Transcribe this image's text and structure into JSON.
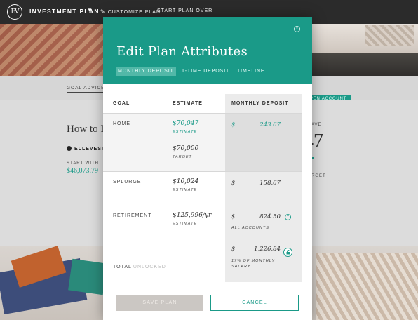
{
  "nav": {
    "logo": "EV",
    "title": "INVESTMENT PLAN",
    "customize": "CUSTOMIZE PLAN",
    "start_over": "START PLAN OVER"
  },
  "background": {
    "goal_advice": "GOAL ADVICE",
    "open_account": "PEN ACCOUNT",
    "heading": "How to I",
    "ellevest": "ELLEVEST",
    "start_with_label": "START WITH",
    "start_with_value": "$46,073.79",
    "save_label": "AVE",
    "big_value": "47",
    "target_label": "RGET"
  },
  "modal": {
    "title": "Edit Plan Attributes",
    "tabs": [
      "MONTHLY DEPOSIT",
      "1-TIME DEPOSIT",
      "TIMELINE"
    ],
    "active_tab": "MONTHLY DEPOSIT",
    "headers": {
      "goal": "GOAL",
      "estimate": "ESTIMATE",
      "deposit": "MONTHLY DEPOSIT"
    },
    "rows": [
      {
        "goal": "HOME",
        "estimate": "$70,047",
        "estimate_label": "ESTIMATE",
        "target": "$70,000",
        "target_label": "TARGET",
        "currency": "$",
        "deposit": "243.67"
      },
      {
        "goal": "SPLURGE",
        "estimate": "$10,024",
        "estimate_label": "ESTIMATE",
        "currency": "$",
        "deposit": "158.67"
      },
      {
        "goal": "RETIREMENT",
        "estimate": "$125,996/yr",
        "estimate_label": "ESTIMATE",
        "currency": "$",
        "deposit": "824.50",
        "note": "ALL ACCOUNTS"
      }
    ],
    "total": {
      "label": "TOTAL",
      "state": "UNLOCKED",
      "currency": "$",
      "value": "1,226.84",
      "note_line1": "17% OF MONTHLY",
      "note_line2": "SALARY"
    },
    "buttons": {
      "save": "SAVE PLAN",
      "cancel": "CANCEL"
    }
  },
  "colors": {
    "accent": "#1a9a88",
    "nav_bg": "#2b2b2b",
    "save_disabled": "#cbc7c3"
  },
  "icons": [
    "close-icon",
    "pencil-icon",
    "chevron-down-icon",
    "plus-circle-icon",
    "lock-icon"
  ]
}
